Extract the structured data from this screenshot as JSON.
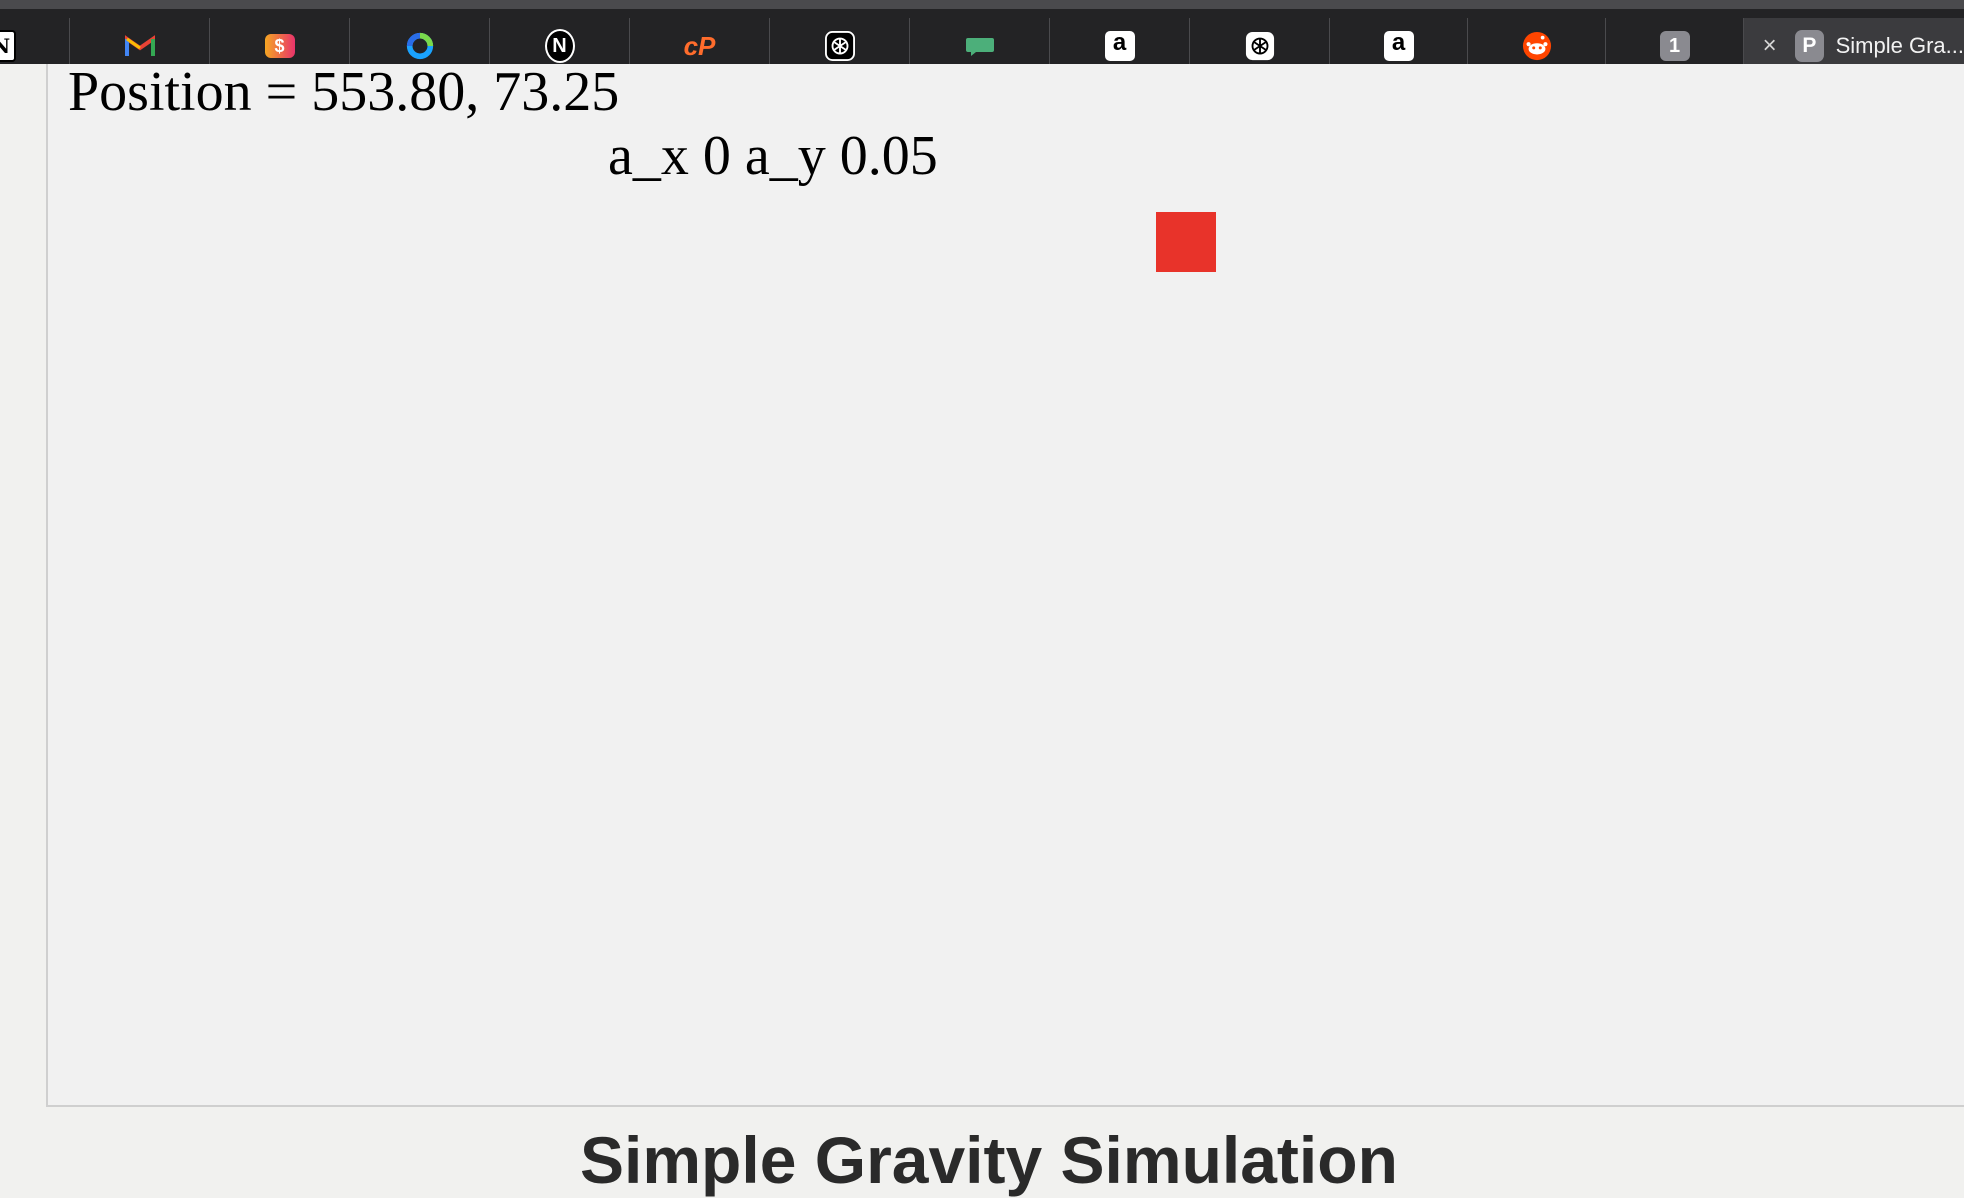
{
  "browser": {
    "tabs": [
      {
        "icon": "notion-icon-partial",
        "label": "N"
      },
      {
        "icon": "gmail-icon",
        "label": "M"
      },
      {
        "icon": "money-app-icon",
        "label": "$"
      },
      {
        "icon": "sync-ring-icon",
        "label": ""
      },
      {
        "icon": "notion-icon",
        "label": "N"
      },
      {
        "icon": "cpanel-icon",
        "label": "cP"
      },
      {
        "icon": "openai-icon",
        "label": ""
      },
      {
        "icon": "chat-bubble-icon",
        "label": ""
      },
      {
        "icon": "amazon-icon",
        "label": "a"
      },
      {
        "icon": "openai-icon",
        "label": ""
      },
      {
        "icon": "amazon-icon",
        "label": "a"
      },
      {
        "icon": "reddit-icon",
        "label": ""
      },
      {
        "icon": "number-badge-icon",
        "label": "1"
      }
    ],
    "active_tab": {
      "close_glyph": "×",
      "favicon_letter": "P",
      "title": "Simple Gra..."
    }
  },
  "simulation": {
    "position_text": "Position = 553.80, 73.25",
    "acceleration_text": "a_x 0 a_y 0.05",
    "ball_color": "#e8332a"
  },
  "page": {
    "heading": "Simple Gravity Simulation"
  },
  "colors": {
    "tabbar_bg": "#232325",
    "active_tab_bg": "#3b3b3e",
    "canvas_bg": "#f1f1f1",
    "ball": "#e8332a"
  }
}
